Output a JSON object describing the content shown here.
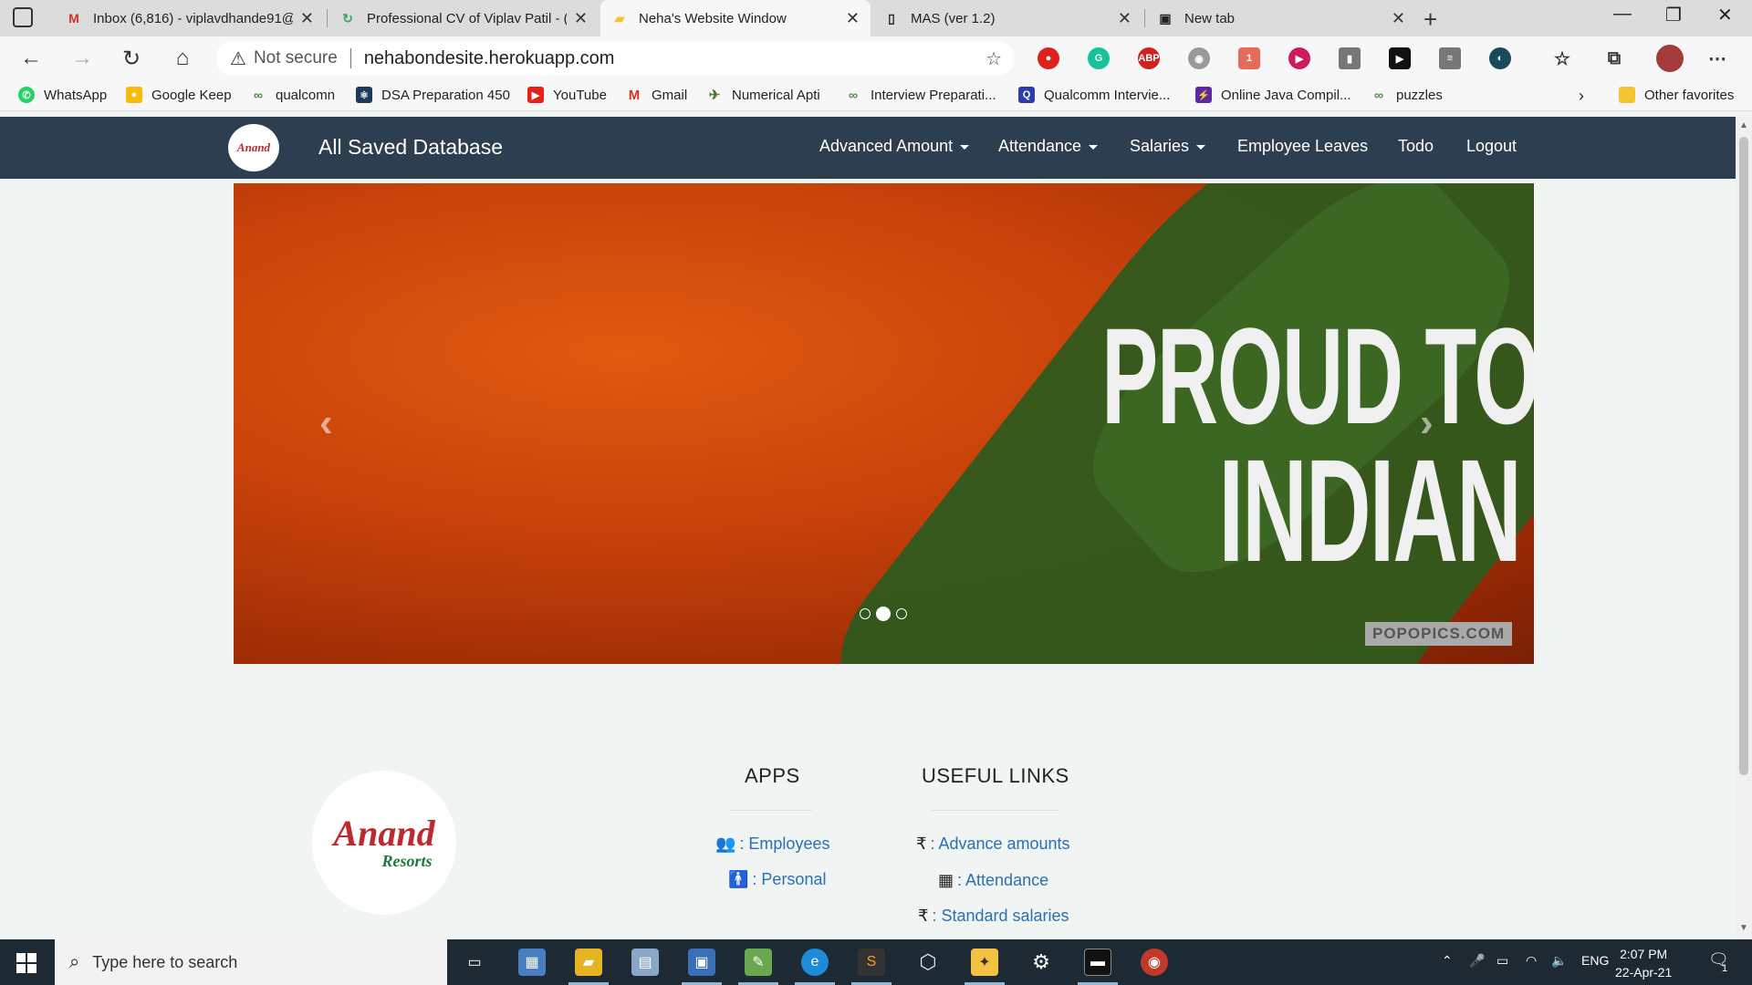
{
  "browser": {
    "tabs": [
      {
        "title": "Inbox (6,816) - viplavdhande91@",
        "icon": "gmail-icon"
      },
      {
        "title": "Professional CV of Viplav Patil - (",
        "icon": "cv-icon"
      },
      {
        "title": "Neha's Website Window",
        "icon": "folder-icon",
        "active": true
      },
      {
        "title": "MAS (ver 1.2)",
        "icon": "document-icon"
      },
      {
        "title": "New tab",
        "icon": "newtab-icon"
      }
    ],
    "security_label": "Not secure",
    "url": "nehabondesite.herokuapp.com",
    "bookmarks": [
      {
        "label": "WhatsApp",
        "color": "#25d366"
      },
      {
        "label": "Google Keep",
        "color": "#f9bb05"
      },
      {
        "label": "qualcomn",
        "color": "#4a8a4a"
      },
      {
        "label": "DSA Preparation 450",
        "color": "#1e3a5a"
      },
      {
        "label": "YouTube",
        "color": "#e62117"
      },
      {
        "label": "Gmail",
        "color": "#d93025"
      },
      {
        "label": "Numerical Apti",
        "color": "#4a7a2a"
      },
      {
        "label": "Interview Preparati...",
        "color": "#4a8a4a"
      },
      {
        "label": "Qualcomm Intervie...",
        "color": "#2e3cb0"
      },
      {
        "label": "Online Java Compil...",
        "color": "#5b2aa0"
      },
      {
        "label": "puzzles",
        "color": "#4a8a4a"
      }
    ],
    "other_favorites": "Other favorites"
  },
  "site": {
    "logo_text": "Anand",
    "brand": "All Saved Database",
    "nav": {
      "advanced_amount": "Advanced Amount",
      "attendance": "Attendance",
      "salaries": "Salaries",
      "employee_leaves": "Employee Leaves",
      "todo": "Todo",
      "logout": "Logout"
    },
    "carousel": {
      "line1": "PROUD TO BE AN",
      "line2": "INDIAN",
      "watermark": "POPOPICS.COM",
      "active_slide": 2,
      "slide_count": 3
    },
    "footer": {
      "logo_line1": "Anand",
      "logo_line2": "Resorts",
      "apps_heading": "APPS",
      "apps": [
        {
          "label": ": Employees",
          "icon": "users-icon"
        },
        {
          "label": ": Personal",
          "icon": "person-icon"
        }
      ],
      "links_heading": "USEFUL LINKS",
      "links": [
        {
          "label": ": Advance amounts",
          "icon": "rupee-icon"
        },
        {
          "label": ": Attendance",
          "icon": "calendar-icon"
        },
        {
          "label": ": Standard salaries",
          "icon": "rupee-icon"
        }
      ]
    }
  },
  "taskbar": {
    "search_placeholder": "Type here to search",
    "language": "ENG",
    "time": "2:07 PM",
    "date": "22-Apr-21",
    "notifications": "1"
  }
}
